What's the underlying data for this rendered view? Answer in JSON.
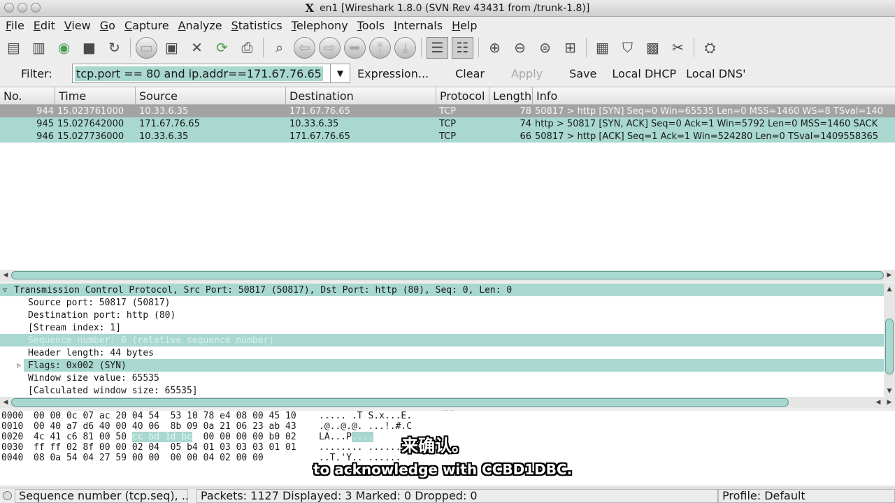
{
  "window": {
    "x_label": "X",
    "title": "en1   [Wireshark 1.8.0  (SVN Rev 43431 from /trunk-1.8)]"
  },
  "menu": [
    "File",
    "Edit",
    "View",
    "Go",
    "Capture",
    "Analyze",
    "Statistics",
    "Telephony",
    "Tools",
    "Internals",
    "Help"
  ],
  "filter": {
    "label": "Filter:",
    "value": "tcp.port == 80 and ip.addr==171.67.76.65",
    "expression_label": "Expression...",
    "clear_label": "Clear",
    "apply_label": "Apply",
    "save_label": "Save",
    "local_dhcp_label": "Local DHCP",
    "local_dns_label": "Local DNS'"
  },
  "packet_list": {
    "columns": [
      "No.",
      "Time",
      "Source",
      "Destination",
      "Protocol",
      "Length",
      "Info"
    ],
    "rows": [
      {
        "no": "944",
        "time": "15.023761000",
        "source": "10.33.6.35",
        "destination": "171.67.76.65",
        "protocol": "TCP",
        "length": "78",
        "info": "50817 > http [SYN] Seq=0 Win=65535 Len=0 MSS=1460 WS=8 TSval=140"
      },
      {
        "no": "945",
        "time": "15.027642000",
        "source": "171.67.76.65",
        "destination": "10.33.6.35",
        "protocol": "TCP",
        "length": "74",
        "info": "http > 50817 [SYN, ACK] Seq=0 Ack=1 Win=5792 Len=0 MSS=1460 SACK"
      },
      {
        "no": "946",
        "time": "15.027736000",
        "source": "10.33.6.35",
        "destination": "171.67.76.65",
        "protocol": "TCP",
        "length": "66",
        "info": "50817 > http [ACK] Seq=1 Ack=1 Win=524280 Len=0 TSval=1409558365"
      }
    ]
  },
  "details": {
    "header": "Transmission Control Protocol, Src Port: 50817 (50817), Dst Port: http (80), Seq: 0, Len: 0",
    "lines": [
      "Source port: 50817 (50817)",
      "Destination port: http (80)",
      "[Stream index: 1]",
      "Sequence number: 0    (relative sequence number)",
      "Header length: 44 bytes",
      "Flags: 0x002 (SYN)",
      "Window size value: 65535",
      "[Calculated window size: 65535]"
    ]
  },
  "bytes": [
    {
      "offset": "0000",
      "hex_a": "00 00 0c 07 ac 20 04 54",
      "hex_b": "53 10 78 e4 08 00 45 10",
      "ascii": "..... .T S.x...E."
    },
    {
      "offset": "0010",
      "hex_a": "00 40 a7 d6 40 00 40 06",
      "hex_b": "8b 09 0a 21 06 23 ab 43",
      "ascii": ".@..@.@. ...!.#.C"
    },
    {
      "offset": "0020",
      "hex_a_pre": "4c 41 c6 81 00 50 ",
      "hex_a_hl": "cc bd 1d bc",
      "hex_b": "00 00 00 00 b0 02",
      "ascii_pre": "LA...P",
      "ascii_hl": "....",
      "ascii_post": ""
    },
    {
      "offset": "0030",
      "hex_a": "ff ff 02 8f 00 00 02 04",
      "hex_b": "05 b4 01 03 03 03 01 01",
      "ascii": "........ ........"
    },
    {
      "offset": "0040",
      "hex_a": "08 0a 54 04 27 59 00 00",
      "hex_b": "00 00 04 02 00 00",
      "ascii": "..T.'Y.. ......"
    }
  ],
  "subtitles": {
    "cn": "来确认。",
    "en": "to acknowledge with CCBD1DBC."
  },
  "status": {
    "field": "Sequence number (tcp.seq), ...",
    "packets": "Packets: 1127 Displayed: 3 Marked: 0 Dropped: 0",
    "profile": "Profile: Default"
  },
  "colors": {
    "tcp_row": "#a8d8cf",
    "selected_row": "#a3a3a3"
  }
}
